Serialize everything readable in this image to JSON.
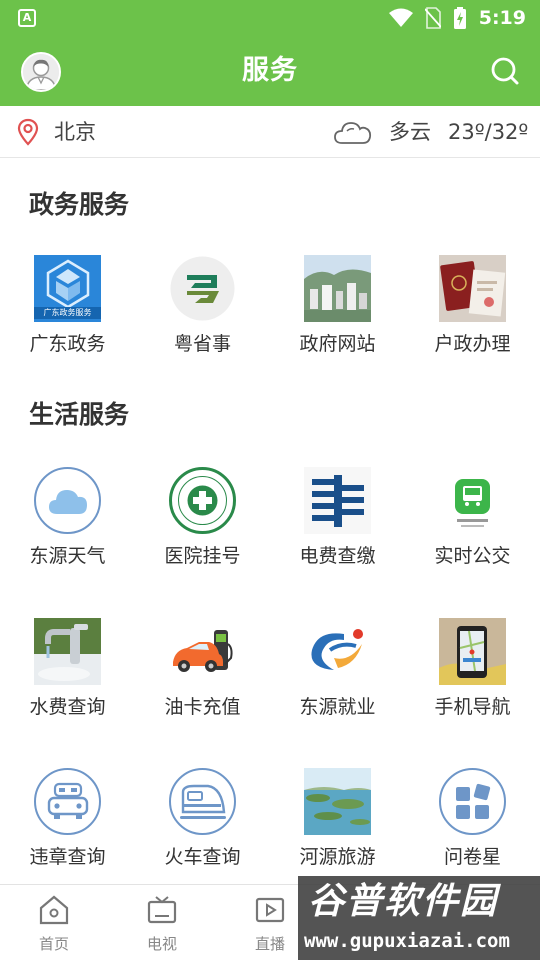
{
  "status_bar": {
    "time": "5:19",
    "app_glyph": "A"
  },
  "header": {
    "title": "服务"
  },
  "location": {
    "city": "北京",
    "weather": "多云",
    "temp": "23º/32º"
  },
  "government": {
    "title": "政务服务",
    "items": [
      {
        "label": "广东政务",
        "icon_caption": "广东政务服务",
        "icon": "guangdong-gov-icon"
      },
      {
        "label": "粤省事",
        "icon": "yueshengshi-icon"
      },
      {
        "label": "政府网站",
        "icon": "city-photo-icon"
      },
      {
        "label": "户政办理",
        "icon": "passport-photo-icon"
      }
    ]
  },
  "life": {
    "title": "生活服务",
    "items": [
      {
        "label": "东源天气",
        "icon": "cloud-icon"
      },
      {
        "label": "医院挂号",
        "icon": "hospital-logo-icon"
      },
      {
        "label": "电费查缴",
        "icon": "power-grid-logo-icon"
      },
      {
        "label": "实时公交",
        "icon": "bus-icon"
      },
      {
        "label": "水费查询",
        "icon": "faucet-icon"
      },
      {
        "label": "油卡充值",
        "icon": "car-charging-icon"
      },
      {
        "label": "东源就业",
        "icon": "employment-logo-icon"
      },
      {
        "label": "手机导航",
        "icon": "phone-map-icon"
      },
      {
        "label": "违章查询",
        "icon": "car-icon"
      },
      {
        "label": "火车查询",
        "icon": "train-icon"
      },
      {
        "label": "河源旅游",
        "icon": "lake-photo-icon"
      },
      {
        "label": "问卷星",
        "icon": "grid-icon"
      }
    ]
  },
  "bottom_nav": [
    {
      "label": "首页",
      "icon": "home-icon"
    },
    {
      "label": "电视",
      "icon": "tv-icon"
    },
    {
      "label": "直播",
      "icon": "live-icon"
    }
  ],
  "watermark": {
    "name": "谷普软件园",
    "url": "www.gupuxiazai.com"
  },
  "colors": {
    "brand_green": "#6cc24a",
    "icon_outline_blue": "#6e96c8",
    "text_dark": "#333333"
  }
}
